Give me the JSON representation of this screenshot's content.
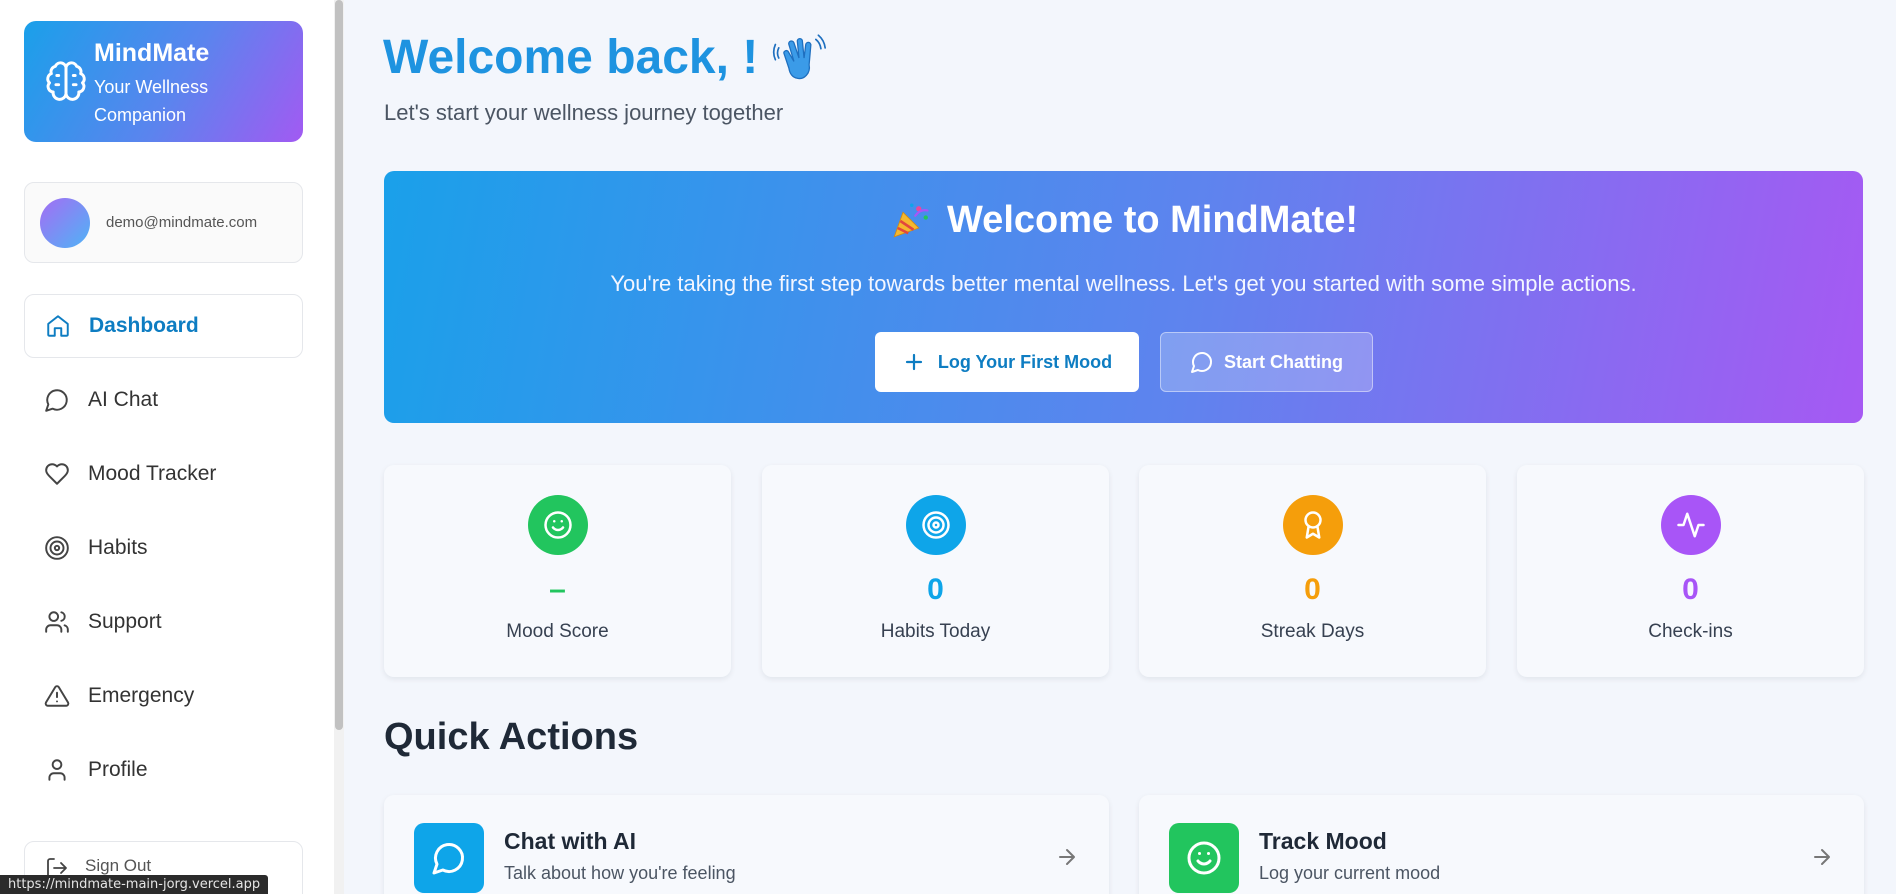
{
  "sidebar": {
    "brand": {
      "name": "MindMate",
      "tagline": "Your Wellness Companion"
    },
    "user": {
      "email": "demo@mindmate.com"
    },
    "nav": [
      {
        "label": "Dashboard",
        "icon": "home-icon",
        "active": true
      },
      {
        "label": "AI Chat",
        "icon": "chat-icon"
      },
      {
        "label": "Mood Tracker",
        "icon": "heart-icon"
      },
      {
        "label": "Habits",
        "icon": "target-icon"
      },
      {
        "label": "Support",
        "icon": "users-icon"
      },
      {
        "label": "Emergency",
        "icon": "alert-triangle-icon"
      },
      {
        "label": "Profile",
        "icon": "user-icon"
      }
    ],
    "signout_label": "Sign Out"
  },
  "status_url": "https://mindmate-main-jorg.vercel.app",
  "header": {
    "title": "Welcome back, !",
    "subtitle": "Let's start your wellness journey together"
  },
  "hero": {
    "title": "Welcome to MindMate!",
    "text": "You're taking the first step towards better mental wellness. Let's get you started with some simple actions.",
    "primary_button": "Log Your First Mood",
    "secondary_button": "Start Chatting"
  },
  "stats": [
    {
      "value": "–",
      "label": "Mood Score",
      "color": "#22c55e",
      "icon": "smile-icon"
    },
    {
      "value": "0",
      "label": "Habits Today",
      "color": "#0ea5e9",
      "icon": "target-icon"
    },
    {
      "value": "0",
      "label": "Streak Days",
      "color": "#f59e0b",
      "icon": "award-icon"
    },
    {
      "value": "0",
      "label": "Check-ins",
      "color": "#a855f7",
      "icon": "activity-icon"
    }
  ],
  "quick_actions": {
    "heading": "Quick Actions",
    "items": [
      {
        "title": "Chat with AI",
        "desc": "Talk about how you're feeling",
        "color": "#0ea5e9",
        "icon": "chat-icon"
      },
      {
        "title": "Track Mood",
        "desc": "Log your current mood",
        "color": "#22c55e",
        "icon": "smile-icon"
      }
    ]
  }
}
